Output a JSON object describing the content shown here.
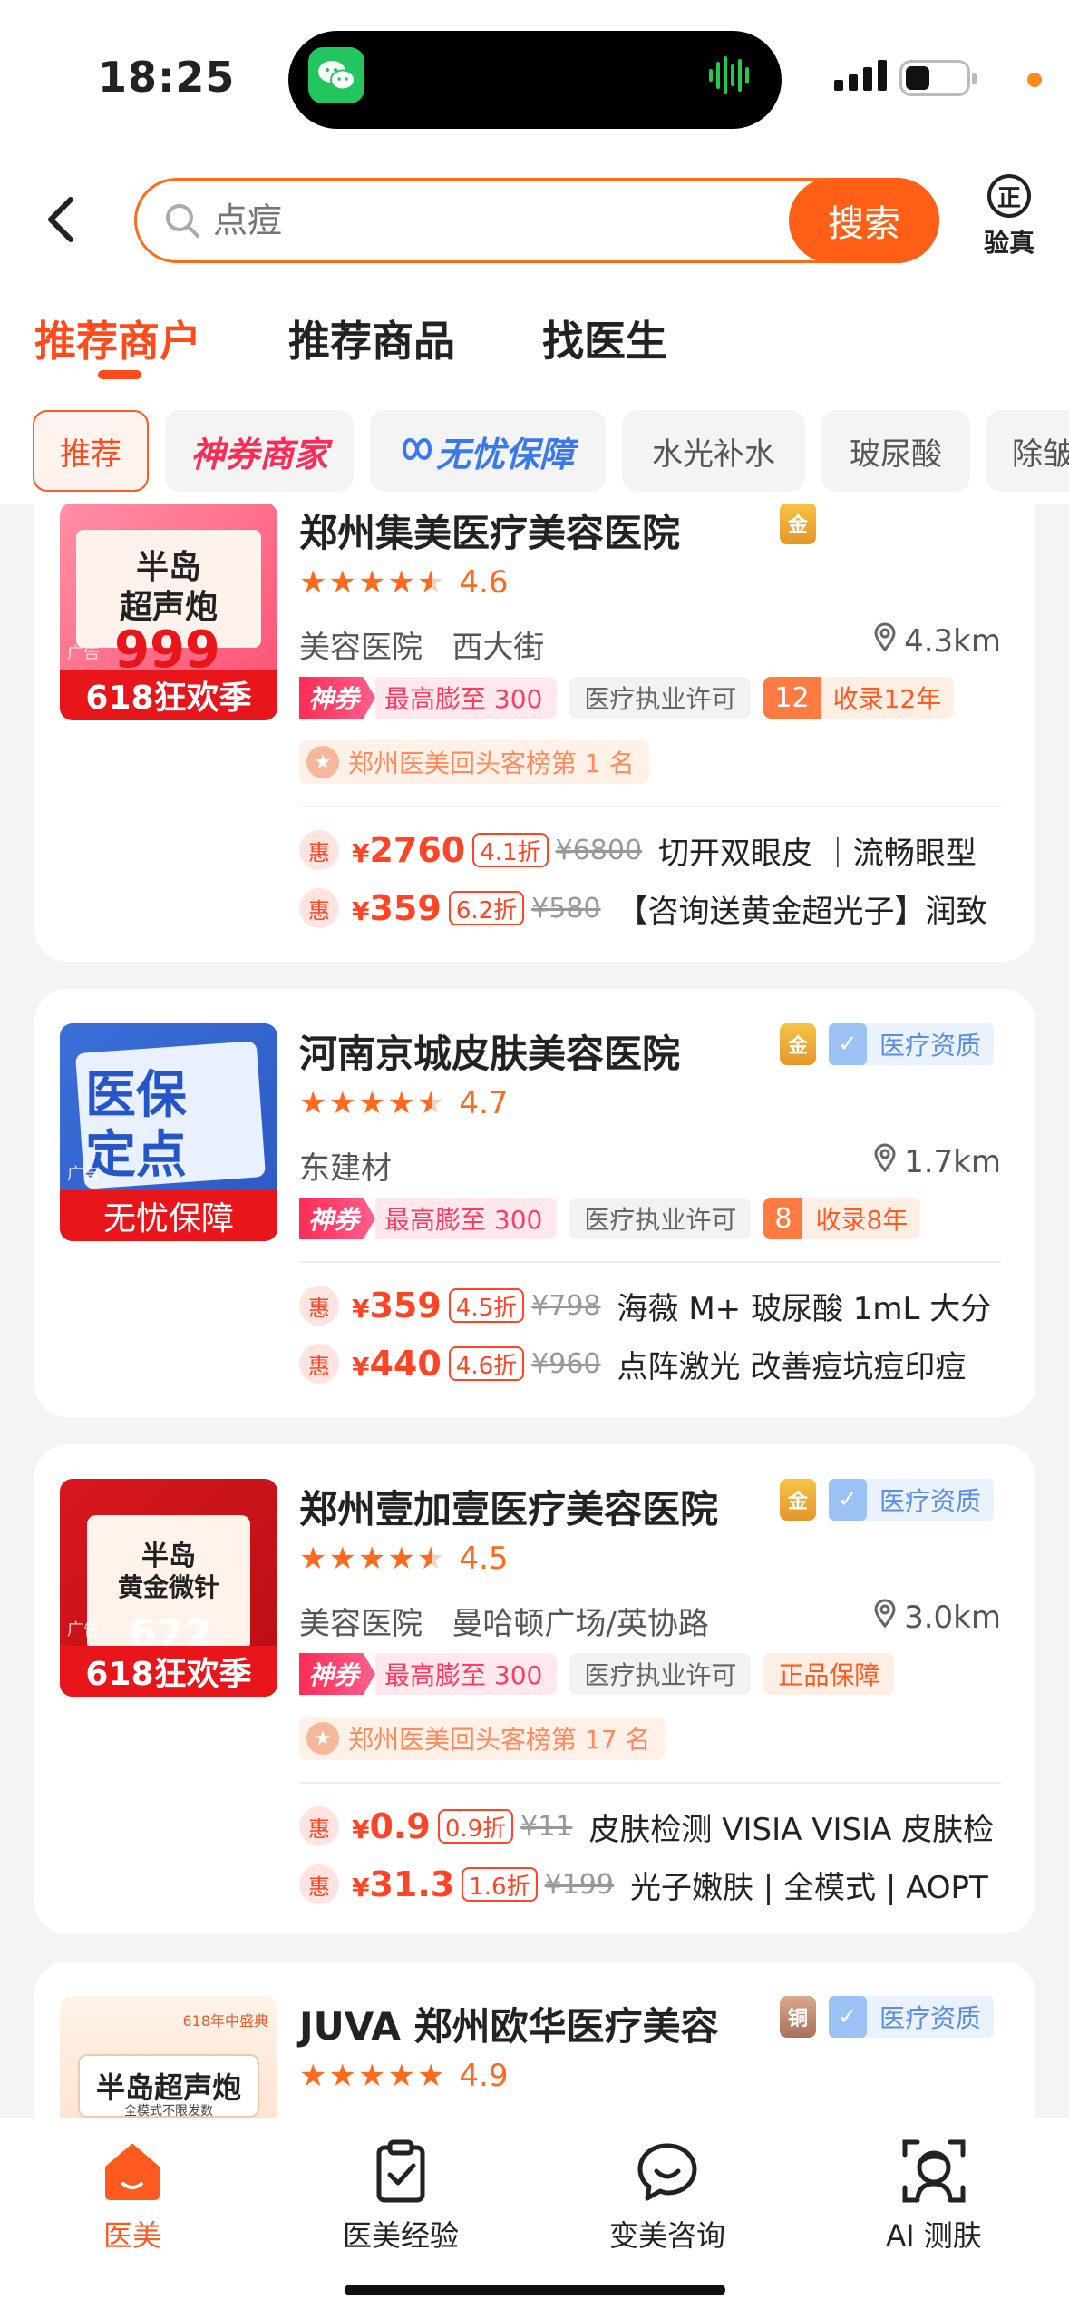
{
  "status_bar": {
    "time": "18:25"
  },
  "search": {
    "placeholder": "点痘",
    "button_label": "搜索"
  },
  "verify": {
    "icon_char": "正",
    "label": "验真"
  },
  "tabs": [
    {
      "label": "推荐商户",
      "active": true
    },
    {
      "label": "推荐商品",
      "active": false
    },
    {
      "label": "找医生",
      "active": false
    }
  ],
  "chips": [
    "推荐",
    "神券商家",
    "无忧保障",
    "水光补水",
    "玻尿酸",
    "除皱"
  ],
  "hospitals": [
    {
      "name": "郑州集美医疗美容医院",
      "medal": "金",
      "thumb_title_1": "半岛",
      "thumb_title_2": "超声炮",
      "thumb_price": "999",
      "thumb_band": "618狂欢季",
      "ad": "广告",
      "rating": 4.6,
      "rating_text": "4.6",
      "category": "美容医院",
      "area": "西大街",
      "distance": "4.3km",
      "shen_logo": "神券",
      "shen_text": "最高膨至 300",
      "license": "医疗执业许可",
      "record_num": "12",
      "record_text": "收录12年",
      "rank": "郑州医美回头客榜第 1 名",
      "deals": [
        {
          "hui": "惠",
          "yen": "¥",
          "price": "2760",
          "discount": "4.1折",
          "original": "¥6800",
          "desc": "切开双眼皮 ｜流畅眼型"
        },
        {
          "hui": "惠",
          "yen": "¥",
          "price": "359",
          "discount": "6.2折",
          "original": "¥580",
          "desc": "【咨询送黄金超光子】润致"
        }
      ]
    },
    {
      "name": "河南京城皮肤美容医院",
      "medal": "金",
      "qualification": "医疗资质",
      "thumb_title_1": "医保",
      "thumb_title_2": "定点",
      "thumb_band": "无忧保障",
      "ad": "广告",
      "rating": 4.7,
      "rating_text": "4.7",
      "category": "东建材",
      "distance": "1.7km",
      "shen_logo": "神券",
      "shen_text": "最高膨至 300",
      "license": "医疗执业许可",
      "record_num": "8",
      "record_text": "收录8年",
      "deals": [
        {
          "hui": "惠",
          "yen": "¥",
          "price": "359",
          "discount": "4.5折",
          "original": "¥798",
          "desc": "海薇 M+ 玻尿酸 1mL 大分"
        },
        {
          "hui": "惠",
          "yen": "¥",
          "price": "440",
          "discount": "4.6折",
          "original": "¥960",
          "desc": "点阵激光 改善痘坑痘印痘"
        }
      ]
    },
    {
      "name": "郑州壹加壹医疗美容医院",
      "medal": "金",
      "qualification": "医疗资质",
      "thumb_title_1": "半岛",
      "thumb_title_2": "黄金微针",
      "thumb_price": "672",
      "thumb_band": "618狂欢季",
      "ad": "广告",
      "rating": 4.5,
      "rating_text": "4.5",
      "category": "美容医院",
      "area": "曼哈顿广场/英协路",
      "distance": "3.0km",
      "shen_logo": "神券",
      "shen_text": "最高膨至 300",
      "license": "医疗执业许可",
      "guarantee": "正品保障",
      "rank": "郑州医美回头客榜第 17 名",
      "deals": [
        {
          "hui": "惠",
          "yen": "¥",
          "price": "0.9",
          "discount": "0.9折",
          "original": "¥11",
          "desc": "皮肤检测 VISIA VISIA 皮肤检"
        },
        {
          "hui": "惠",
          "yen": "¥",
          "price": "31.3",
          "discount": "1.6折",
          "original": "¥199",
          "desc": "光子嫩肤 | 全模式 | AOPT"
        }
      ]
    },
    {
      "name": "JUVA 郑州欧华医疗美容",
      "medal": "铜",
      "qualification": "医疗资质",
      "thumb_top": "618年中盛典",
      "thumb_title_1": "半岛超声炮",
      "thumb_sub": "全模式不限发数",
      "rating": 4.9,
      "rating_text": "4.9"
    }
  ],
  "bottom_nav": [
    {
      "label": "医美",
      "icon": "home-icon",
      "active": true
    },
    {
      "label": "医美经验",
      "icon": "clipboard-check-icon",
      "active": false
    },
    {
      "label": "变美咨询",
      "icon": "chat-smile-icon",
      "active": false
    },
    {
      "label": "AI 测肤",
      "icon": "face-scan-icon",
      "active": false
    }
  ],
  "colors": {
    "accent": "#ff5a1f",
    "price": "#ff4526",
    "shen": "#ff2d55",
    "qualification": "#5b8fde"
  }
}
